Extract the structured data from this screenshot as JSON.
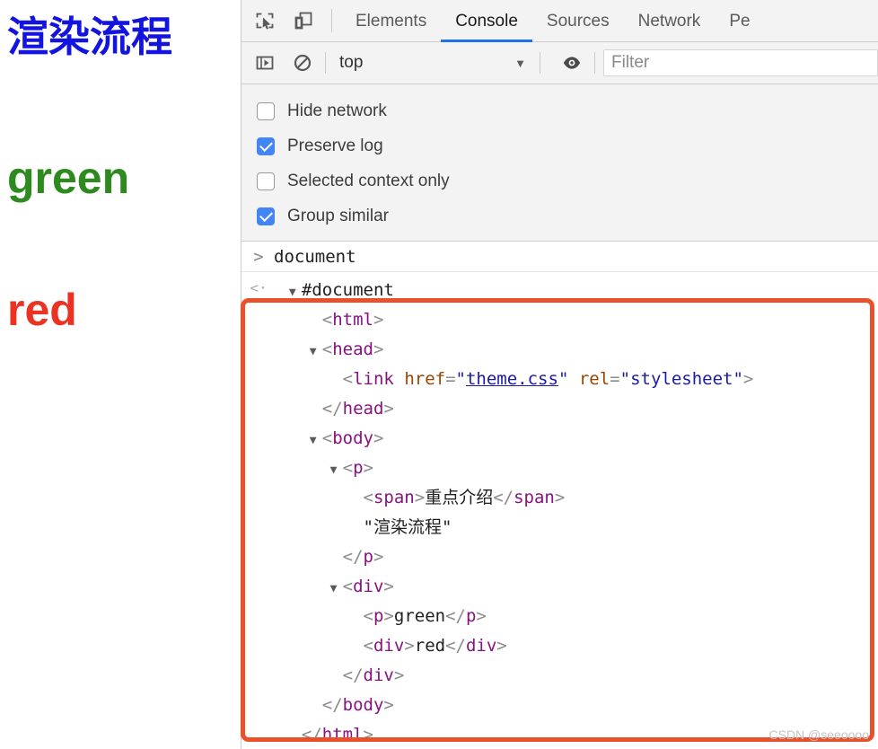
{
  "page_view": {
    "lines": [
      {
        "text": "渲染流程",
        "color": "#1414e0"
      },
      {
        "text": "green",
        "color": "#2e8a1e"
      },
      {
        "text": "red",
        "color": "#ea3323"
      }
    ]
  },
  "devtools": {
    "toolbar_icons": [
      {
        "name": "inspect-element-icon",
        "title": "Inspect element"
      },
      {
        "name": "device-toolbar-icon",
        "title": "Toggle device toolbar"
      }
    ],
    "tabs": [
      {
        "label": "Elements",
        "active": false
      },
      {
        "label": "Console",
        "active": true
      },
      {
        "label": "Sources",
        "active": false
      },
      {
        "label": "Network",
        "active": false
      },
      {
        "label": "Pe",
        "active": false
      }
    ],
    "active_tab_color": "#1a73e8",
    "filter_bar": {
      "sidebar_icon": "show-console-sidebar-icon",
      "clear_icon": "clear-console-icon",
      "context": "top",
      "caret": "▼",
      "eye_icon": "live-expression-eye-icon",
      "filter_value": "",
      "filter_placeholder": "Filter"
    },
    "settings": [
      {
        "label": "Hide network",
        "checked": false
      },
      {
        "label": "Preserve log",
        "checked": true
      },
      {
        "label": "Selected context only",
        "checked": false
      },
      {
        "label": "Group similar",
        "checked": true
      }
    ],
    "console": {
      "prompt_marker": ">",
      "command": "document",
      "result_marker": "<·",
      "dom_tree": [
        {
          "indent": 0,
          "triangle": "▼",
          "parts": [
            {
              "t": "txt",
              "s": "#document"
            }
          ]
        },
        {
          "indent": 1,
          "triangle": "",
          "parts": [
            {
              "t": "ang",
              "s": "<"
            },
            {
              "t": "tag",
              "s": "html"
            },
            {
              "t": "ang",
              "s": ">"
            }
          ]
        },
        {
          "indent": 1,
          "triangle": "▼",
          "parts": [
            {
              "t": "ang",
              "s": "<"
            },
            {
              "t": "tag",
              "s": "head"
            },
            {
              "t": "ang",
              "s": ">"
            }
          ]
        },
        {
          "indent": 2,
          "triangle": "",
          "parts": [
            {
              "t": "ang",
              "s": "<"
            },
            {
              "t": "tag",
              "s": "link"
            },
            {
              "t": "txt",
              "s": " "
            },
            {
              "t": "attr",
              "s": "href"
            },
            {
              "t": "ang",
              "s": "="
            },
            {
              "t": "val",
              "s": "\""
            },
            {
              "t": "link",
              "s": "theme.css"
            },
            {
              "t": "val",
              "s": "\""
            },
            {
              "t": "txt",
              "s": " "
            },
            {
              "t": "attr",
              "s": "rel"
            },
            {
              "t": "ang",
              "s": "="
            },
            {
              "t": "val",
              "s": "\"stylesheet\""
            },
            {
              "t": "ang",
              "s": ">"
            }
          ]
        },
        {
          "indent": 1,
          "triangle": "",
          "parts": [
            {
              "t": "ang",
              "s": "</"
            },
            {
              "t": "tag",
              "s": "head"
            },
            {
              "t": "ang",
              "s": ">"
            }
          ]
        },
        {
          "indent": 1,
          "triangle": "▼",
          "parts": [
            {
              "t": "ang",
              "s": "<"
            },
            {
              "t": "tag",
              "s": "body"
            },
            {
              "t": "ang",
              "s": ">"
            }
          ]
        },
        {
          "indent": 2,
          "triangle": "▼",
          "parts": [
            {
              "t": "ang",
              "s": "<"
            },
            {
              "t": "tag",
              "s": "p"
            },
            {
              "t": "ang",
              "s": ">"
            }
          ]
        },
        {
          "indent": 3,
          "triangle": "",
          "parts": [
            {
              "t": "ang",
              "s": "<"
            },
            {
              "t": "tag",
              "s": "span"
            },
            {
              "t": "ang",
              "s": ">"
            },
            {
              "t": "txt",
              "s": "重点介绍"
            },
            {
              "t": "ang",
              "s": "</"
            },
            {
              "t": "tag",
              "s": "span"
            },
            {
              "t": "ang",
              "s": ">"
            }
          ]
        },
        {
          "indent": 3,
          "triangle": "",
          "parts": [
            {
              "t": "txt",
              "s": "\"渲染流程\""
            }
          ]
        },
        {
          "indent": 2,
          "triangle": "",
          "parts": [
            {
              "t": "ang",
              "s": "</"
            },
            {
              "t": "tag",
              "s": "p"
            },
            {
              "t": "ang",
              "s": ">"
            }
          ]
        },
        {
          "indent": 2,
          "triangle": "▼",
          "parts": [
            {
              "t": "ang",
              "s": "<"
            },
            {
              "t": "tag",
              "s": "div"
            },
            {
              "t": "ang",
              "s": ">"
            }
          ]
        },
        {
          "indent": 3,
          "triangle": "",
          "parts": [
            {
              "t": "ang",
              "s": "<"
            },
            {
              "t": "tag",
              "s": "p"
            },
            {
              "t": "ang",
              "s": ">"
            },
            {
              "t": "txt",
              "s": "green"
            },
            {
              "t": "ang",
              "s": "</"
            },
            {
              "t": "tag",
              "s": "p"
            },
            {
              "t": "ang",
              "s": ">"
            }
          ]
        },
        {
          "indent": 3,
          "triangle": "",
          "parts": [
            {
              "t": "ang",
              "s": "<"
            },
            {
              "t": "tag",
              "s": "div"
            },
            {
              "t": "ang",
              "s": ">"
            },
            {
              "t": "txt",
              "s": "red"
            },
            {
              "t": "ang",
              "s": "</"
            },
            {
              "t": "tag",
              "s": "div"
            },
            {
              "t": "ang",
              "s": ">"
            }
          ]
        },
        {
          "indent": 2,
          "triangle": "",
          "parts": [
            {
              "t": "ang",
              "s": "</"
            },
            {
              "t": "tag",
              "s": "div"
            },
            {
              "t": "ang",
              "s": ">"
            }
          ]
        },
        {
          "indent": 1,
          "triangle": "",
          "parts": [
            {
              "t": "ang",
              "s": "</"
            },
            {
              "t": "tag",
              "s": "body"
            },
            {
              "t": "ang",
              "s": ">"
            }
          ]
        },
        {
          "indent": 0,
          "triangle": "",
          "parts": [
            {
              "t": "ang",
              "s": "</"
            },
            {
              "t": "tag",
              "s": "html"
            },
            {
              "t": "ang",
              "s": ">"
            }
          ]
        }
      ]
    }
  },
  "annotation": {
    "border_color": "#ea502a"
  },
  "watermark": "CSDN @seeoooo"
}
